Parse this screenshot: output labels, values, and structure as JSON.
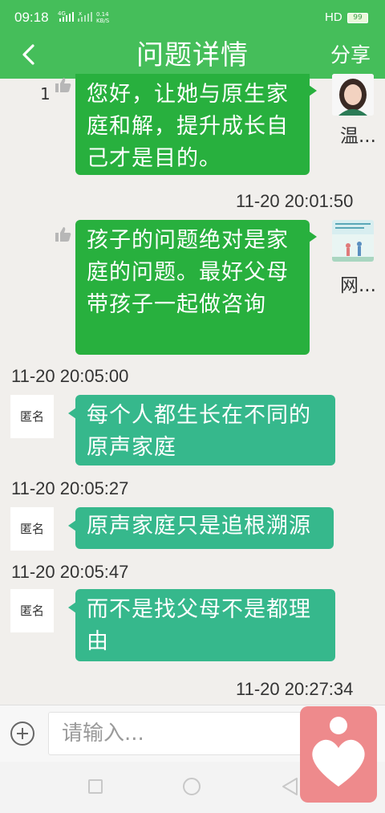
{
  "status": {
    "time": "09:18",
    "sim1": "4G",
    "sim2": "x",
    "speed_value": "0.14",
    "speed_unit": "KB/S",
    "hd": "HD",
    "battery": "99"
  },
  "header": {
    "title": "问题详情",
    "share_label": "分享"
  },
  "messages": [
    {
      "side": "right",
      "text": "您好，让她与原生家庭和解，提升成长自己才是目的。",
      "likes": "1",
      "author": "温..."
    },
    {
      "timestamp": "11-20 20:01:50"
    },
    {
      "side": "right",
      "text": "孩子的问题绝对是家庭的问题。最好父母带孩子一起做咨询",
      "author": "网..."
    },
    {
      "timestamp": "11-20 20:05:00"
    },
    {
      "side": "left",
      "text": "每个人都生长在不同的原声家庭",
      "author": "匿名"
    },
    {
      "timestamp": "11-20 20:05:27"
    },
    {
      "side": "left",
      "text": "原声家庭只是追根溯源",
      "author": "匿名"
    },
    {
      "timestamp": "11-20 20:05:47"
    },
    {
      "side": "left",
      "text": "而不是找父母不是都理由",
      "author": "匿名"
    },
    {
      "timestamp": "11-20 20:27:34"
    }
  ],
  "composer": {
    "placeholder": "请输入..."
  },
  "colors": {
    "primary": "#45be5a",
    "bubble_right": "#28b03e",
    "bubble_left": "#36b88c",
    "fab": "#ee8a8c"
  },
  "icons": [
    "back-arrow-icon",
    "thumb-up-icon",
    "plus-icon",
    "heart-logo-icon",
    "nav-square-icon",
    "nav-circle-icon",
    "nav-back-icon"
  ]
}
